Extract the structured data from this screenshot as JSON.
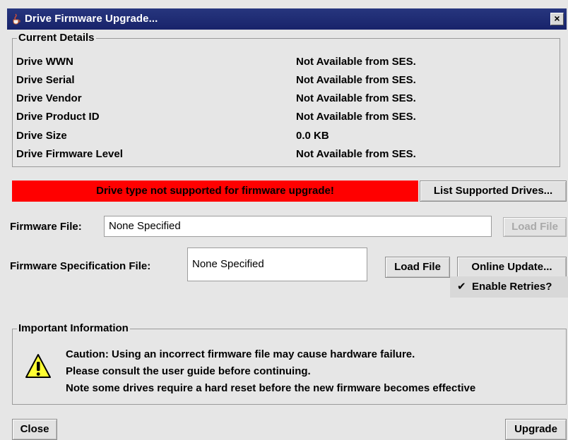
{
  "window": {
    "title": "Drive Firmware Upgrade...",
    "close_label": "×"
  },
  "current_details": {
    "title": "Current Details",
    "rows": [
      {
        "label": "Drive WWN",
        "value": "Not Available from SES."
      },
      {
        "label": "Drive Serial",
        "value": "Not Available from SES."
      },
      {
        "label": "Drive Vendor",
        "value": "Not Available from SES."
      },
      {
        "label": "Drive Product ID",
        "value": "Not Available from SES."
      },
      {
        "label": "Drive Size",
        "value": "0.0 KB"
      },
      {
        "label": "Drive Firmware Level",
        "value": "Not Available from SES."
      }
    ]
  },
  "banner": {
    "text": "Drive type not supported for firmware upgrade!"
  },
  "buttons": {
    "list_supported": "List Supported Drives...",
    "load_file_1": "Load File",
    "load_file_2": "Load File",
    "online_update": "Online Update...",
    "close": "Close",
    "upgrade": "Upgrade"
  },
  "firmware_file": {
    "label": "Firmware File:",
    "value": "None Specified"
  },
  "spec_file": {
    "label": "Firmware Specification File:",
    "value": "None Specified"
  },
  "retries": {
    "label": "Enable Retries?",
    "checked": true,
    "check_mark": "✔"
  },
  "important": {
    "title": "Important Information",
    "lines": [
      "Caution: Using an incorrect firmware file may cause hardware failure.",
      "Please consult the user guide before continuing.",
      "Note some drives require a hard reset before the new firmware becomes effective"
    ]
  },
  "colors": {
    "titlebar": "#1f2c74",
    "banner": "#ff0000",
    "warning_icon": "#ffff33"
  }
}
